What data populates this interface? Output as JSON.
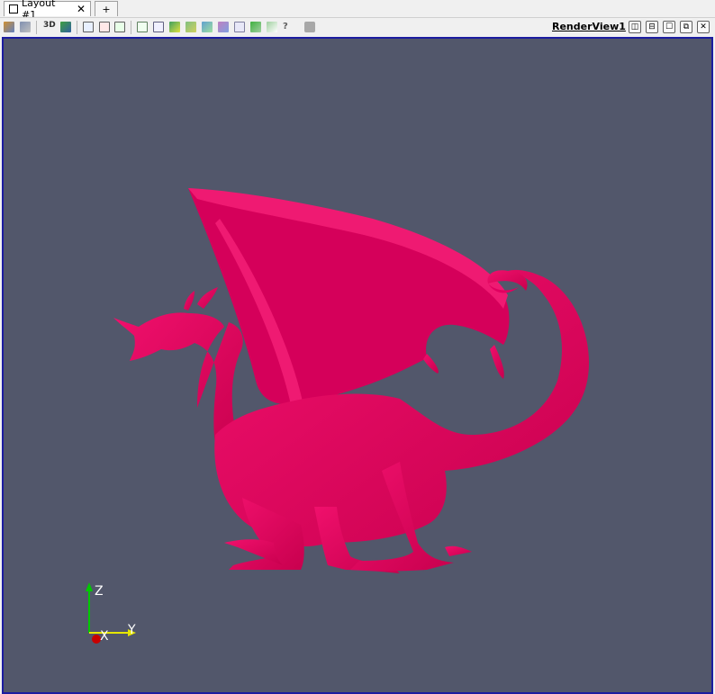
{
  "tabs": {
    "layout_label": "Layout #1",
    "close_glyph": "✕",
    "add_label": "+"
  },
  "toolbar": {
    "three_d_label": "3D",
    "view_name": "RenderView1",
    "buttons": [
      "reset-camera",
      "zoom-to-data",
      "toggle-3d",
      "capture-screenshot",
      "set-view-x-plus",
      "set-view-x-minus",
      "set-view-y-plus",
      "select-cells-on",
      "select-points-on",
      "select-cells-frustum",
      "select-points-frustum",
      "select-block",
      "interactive-select",
      "select-polygon",
      "hover-points",
      "hover-cells",
      "clear-selection"
    ]
  },
  "view_controls": {
    "split_horizontal": "◫",
    "split_vertical": "⊟",
    "maximize": "☐",
    "float": "⧉",
    "close": "✕"
  },
  "render": {
    "background_color": "#52576b",
    "model_color": "#e6005c",
    "model_name": "dragon",
    "orientation_axes": {
      "x_label": "X",
      "y_label": "Y",
      "z_label": "Z",
      "x_color": "#c80000",
      "y_color": "#e6e600",
      "z_color": "#00c800"
    }
  }
}
